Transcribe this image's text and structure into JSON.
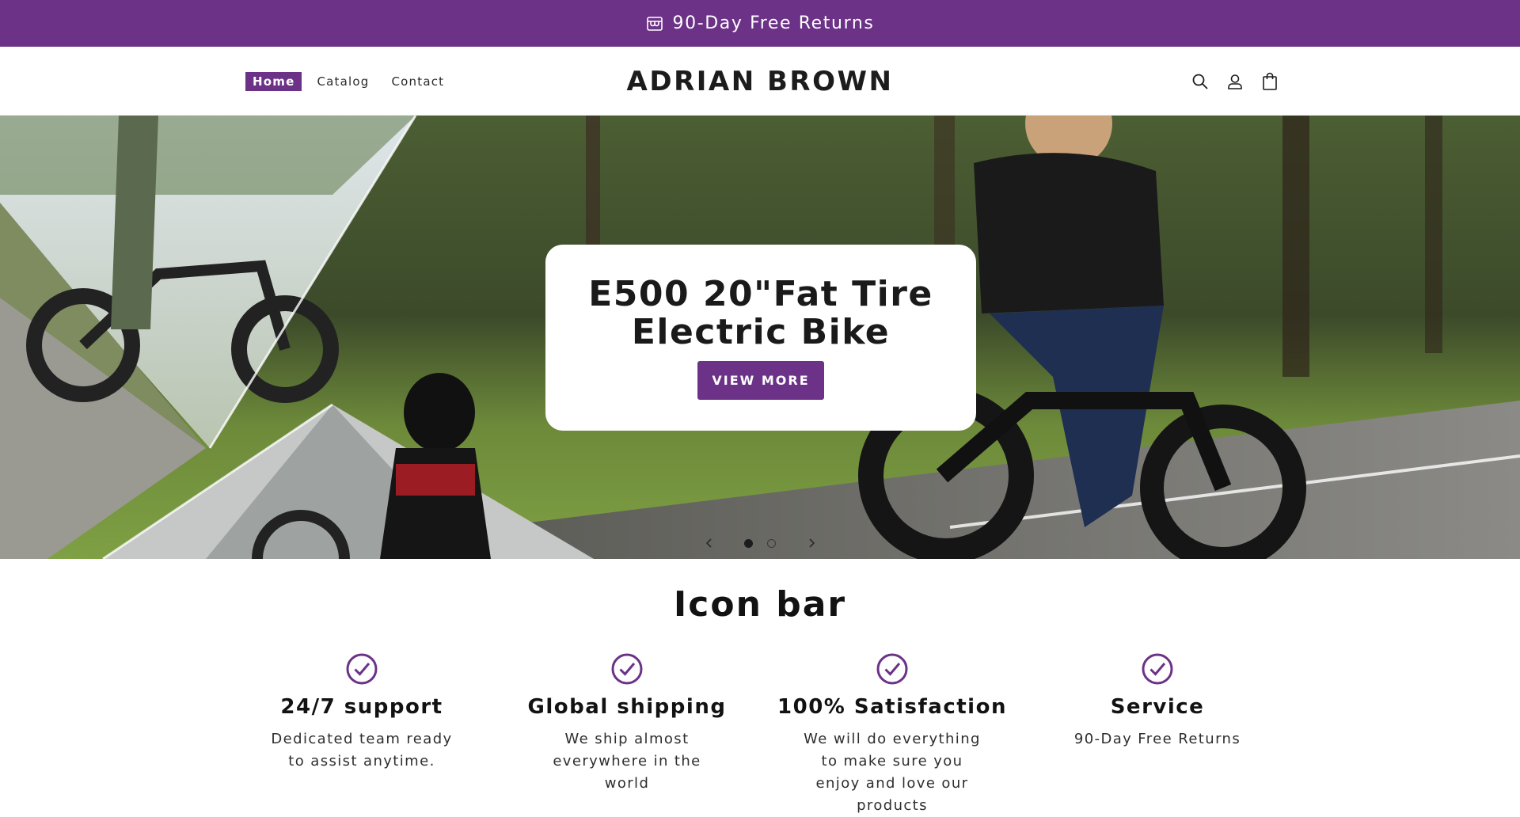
{
  "announcement": {
    "text": "90-Day Free Returns",
    "icon": "store-icon"
  },
  "header": {
    "nav": [
      {
        "label": "Home",
        "active": true
      },
      {
        "label": "Catalog",
        "active": false
      },
      {
        "label": "Contact",
        "active": false
      }
    ],
    "brand": "ADRIAN BROWN",
    "icons": [
      "search-icon",
      "account-icon",
      "cart-icon"
    ]
  },
  "hero": {
    "title_line1": "E500 20\"Fat Tire",
    "title_line2": "Electric Bike",
    "button_label": "VIEW MORE",
    "slides_total": 2,
    "active_slide": 1
  },
  "icon_bar": {
    "title": "Icon bar",
    "items": [
      {
        "icon": "check-circle-icon",
        "title": "24/7 support",
        "desc": "Dedicated team ready to assist anytime."
      },
      {
        "icon": "check-circle-icon",
        "title": "Global shipping",
        "desc": "We ship almost everywhere in the world"
      },
      {
        "icon": "check-circle-icon",
        "title": "100% Satisfaction",
        "desc": "We will do everything to make sure you enjoy and love our products"
      },
      {
        "icon": "check-circle-icon",
        "title": "Service",
        "desc": "90-Day Free Returns"
      }
    ]
  },
  "colors": {
    "accent": "#6b3287",
    "text": "#121212",
    "background": "#ffffff"
  }
}
